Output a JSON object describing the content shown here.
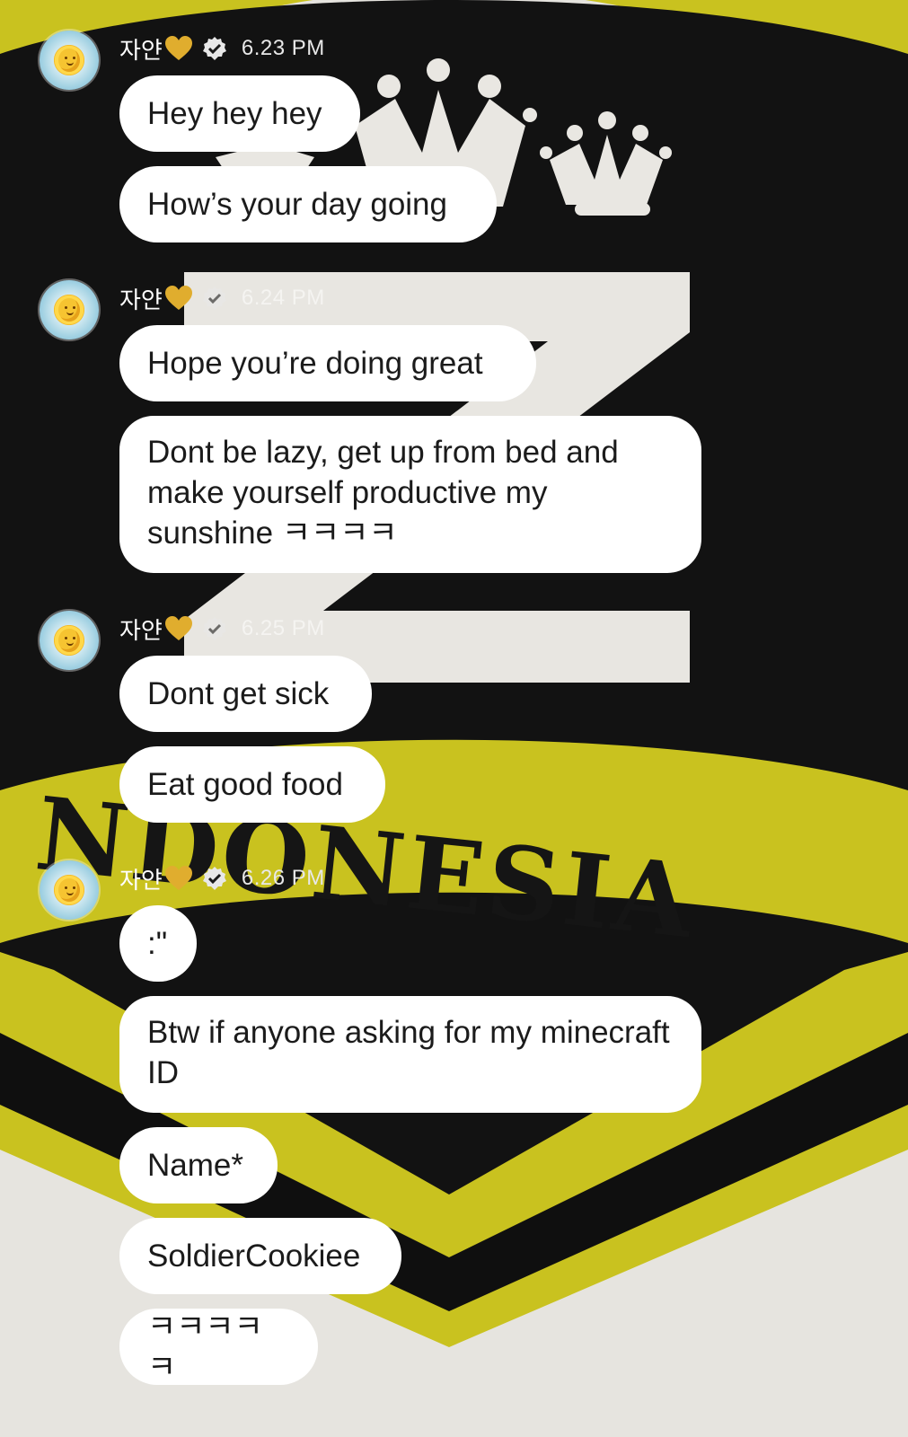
{
  "sender": {
    "name": "자얀",
    "name_emoji_icon": "yellow-heart-icon",
    "verified_icon": "verified-check-icon",
    "avatar_icon": "sun-avatar-icon"
  },
  "background": {
    "word": "NDONESIA",
    "colors": {
      "yellow": "#c9c21f",
      "black": "#121212",
      "white": "#e6e4df"
    }
  },
  "groups": [
    {
      "time": "6.23 PM",
      "messages": [
        "Hey hey hey",
        "How’s your day going"
      ]
    },
    {
      "time": "6.24 PM",
      "messages": [
        "Hope you’re doing great",
        "Dont be lazy, get up from bed and make yourself productive my sunshine ㅋㅋㅋㅋ"
      ]
    },
    {
      "time": "6.25 PM",
      "messages": [
        "Dont get sick",
        "Eat good food"
      ]
    },
    {
      "time": "6.26 PM",
      "messages": [
        ":\"",
        "Btw if anyone asking for my minecraft ID",
        "Name*",
        "SoldierCookiee",
        "ㅋㅋㅋㅋㅋ"
      ]
    }
  ]
}
